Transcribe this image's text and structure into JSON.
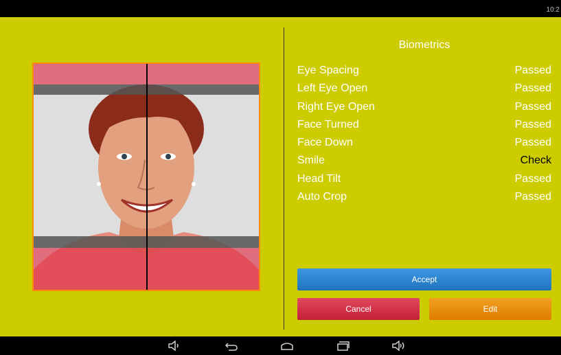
{
  "status_bar": {
    "time": "10:2"
  },
  "biometrics": {
    "title": "Biometrics",
    "checks": [
      {
        "label": "Eye Spacing",
        "status": "Passed"
      },
      {
        "label": "Left Eye Open",
        "status": "Passed"
      },
      {
        "label": "Right Eye Open",
        "status": "Passed"
      },
      {
        "label": "Face Turned",
        "status": "Passed"
      },
      {
        "label": "Face Down",
        "status": "Passed"
      },
      {
        "label": "Smile",
        "status": "Check"
      },
      {
        "label": "Head Tilt",
        "status": "Passed"
      },
      {
        "label": "Auto Crop",
        "status": "Passed"
      }
    ]
  },
  "buttons": {
    "accept": "Accept",
    "cancel": "Cancel",
    "edit": "Edit"
  },
  "nav": [
    "volume-down-icon",
    "back-icon",
    "home-icon",
    "recents-icon",
    "volume-up-icon"
  ],
  "colors": {
    "background": "#cccc00",
    "accept": "#2f86d3",
    "cancel": "#d6344a",
    "edit": "#ea8e10",
    "frame_border": "#ff8c00",
    "passed_text": "#ffffff",
    "check_text": "#000000"
  }
}
